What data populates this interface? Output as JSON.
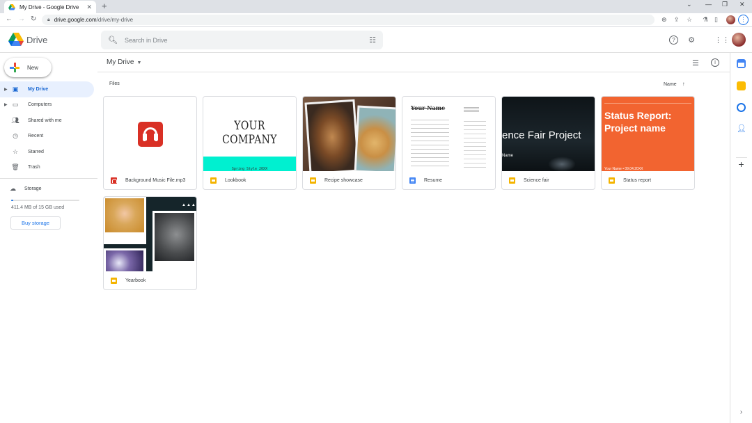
{
  "browser": {
    "tab_title": "My Drive - Google Drive",
    "tab_close": "✕",
    "new_tab": "+",
    "url_host": "drive.google.com",
    "url_path": "/drive/my-drive",
    "window_controls": [
      "⌄",
      "—",
      "❐",
      "✕"
    ]
  },
  "app": {
    "brand": "Drive",
    "search_placeholder": "Search in Drive"
  },
  "sidebar": {
    "new_label": "New",
    "items": [
      {
        "label": "My Drive",
        "icon": "my-drive-icon",
        "active": true,
        "expandable": true
      },
      {
        "label": "Computers",
        "icon": "computers-icon",
        "active": false,
        "expandable": true
      },
      {
        "label": "Shared with me",
        "icon": "shared-icon",
        "active": false,
        "expandable": false
      },
      {
        "label": "Recent",
        "icon": "clock-icon",
        "active": false,
        "expandable": false
      },
      {
        "label": "Starred",
        "icon": "star-icon",
        "active": false,
        "expandable": false
      },
      {
        "label": "Trash",
        "icon": "trash-icon",
        "active": false,
        "expandable": false
      }
    ],
    "storage_label": "Storage",
    "storage_used_text": "411.4 MB of 15 GB used",
    "storage_fraction": 0.027,
    "buy_storage": "Buy storage"
  },
  "main": {
    "breadcrumb": "My Drive",
    "section_title": "Files",
    "sort_label": "Name",
    "files": [
      {
        "name": "Background Music File.mp3",
        "type": "audio"
      },
      {
        "name": "Lookbook",
        "type": "slides",
        "thumb_title": "YOUR COMPANY",
        "thumb_sub": "Spring Style 20XX"
      },
      {
        "name": "Recipe showcase",
        "type": "slides"
      },
      {
        "name": "Resume",
        "type": "docs",
        "thumb_title": "Your Name"
      },
      {
        "name": "Science fair",
        "type": "slides",
        "thumb_title": "ence Fair Project",
        "thumb_sub": "Name"
      },
      {
        "name": "Status report",
        "type": "slides",
        "thumb_title": "Status Report: Project name",
        "thumb_sub": "Your Name • 09.04.20XX"
      },
      {
        "name": "Yearbook",
        "type": "slides"
      }
    ]
  },
  "colors": {
    "accent": "#1a73e8",
    "active_bg": "#e8f0fe",
    "slides": "#f4b400",
    "docs": "#4285f4",
    "audio": "#d93025",
    "status_orange": "#f26430",
    "lookbook_teal": "#00f0d0"
  }
}
